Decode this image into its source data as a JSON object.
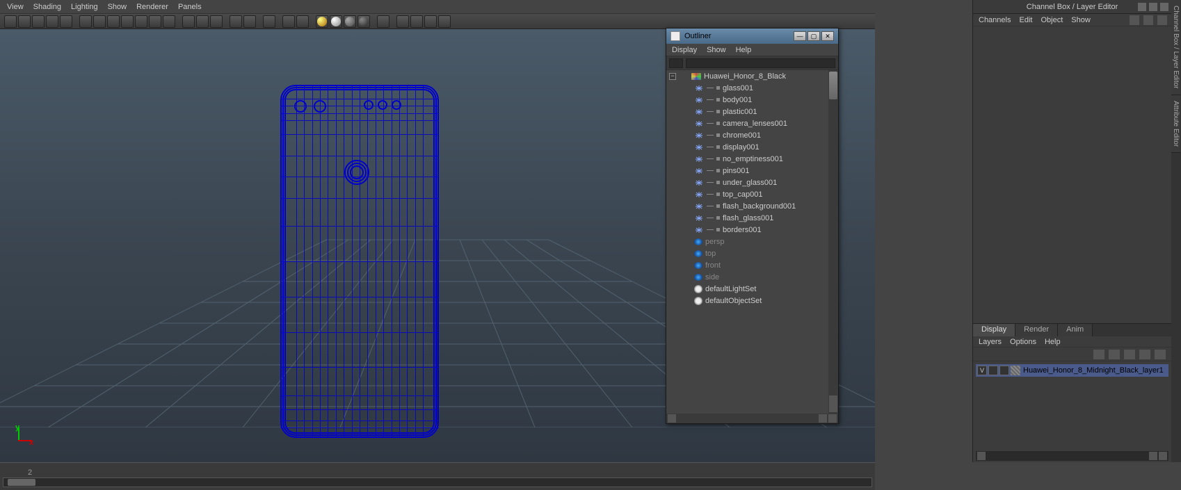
{
  "viewport": {
    "menus": [
      "View",
      "Shading",
      "Lighting",
      "Show",
      "Renderer",
      "Panels"
    ]
  },
  "outliner": {
    "title": "Outliner",
    "menus": [
      "Display",
      "Show",
      "Help"
    ],
    "root": "Huawei_Honor_8_Black",
    "children": [
      "glass001",
      "body001",
      "plastic001",
      "camera_lenses001",
      "chrome001",
      "display001",
      "no_emptiness001",
      "pins001",
      "under_glass001",
      "top_cap001",
      "flash_background001",
      "flash_glass001",
      "borders001"
    ],
    "cameras": [
      "persp",
      "top",
      "front",
      "side"
    ],
    "sets": [
      "defaultLightSet",
      "defaultObjectSet"
    ]
  },
  "channelbox": {
    "title": "Channel Box / Layer Editor",
    "menus": [
      "Channels",
      "Edit",
      "Object",
      "Show"
    ]
  },
  "layers": {
    "tabs": [
      "Display",
      "Render",
      "Anim"
    ],
    "active_tab": "Display",
    "menus": [
      "Layers",
      "Options",
      "Help"
    ],
    "rows": [
      {
        "vis": "V",
        "layer_name": "Huawei_Honor_8_Midnight_Black_layer1"
      }
    ]
  },
  "side_tabs": [
    "Channel Box / Layer Editor",
    "Attribute Editor"
  ],
  "timeline": {
    "ticks": [
      "2"
    ]
  },
  "axis": {
    "y": "y",
    "x": "x"
  }
}
